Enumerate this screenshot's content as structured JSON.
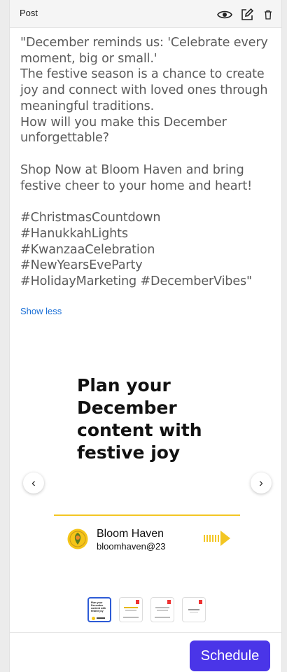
{
  "header": {
    "title": "Post",
    "icons": [
      "eye-icon",
      "edit-icon",
      "trash-icon"
    ]
  },
  "caption": {
    "paragraph1": "\"December reminds us: 'Celebrate every moment, big or small.'\nThe festive season is a chance to create joy and connect with loved ones through meaningful traditions.\nHow will you make this December unforgettable?",
    "paragraph2": "Shop Now at Bloom Haven and bring festive cheer to your home and heart!",
    "paragraph3": "#ChristmasCountdown\n#HanukkahLights\n#KwanzaaCelebration\n#NewYearsEveParty\n#HolidayMarketing #DecemberVibes\"",
    "toggle_label": "Show less"
  },
  "slide": {
    "headline": "Plan your December content with festive joy",
    "brand_name": "Bloom Haven",
    "brand_handle": "bloomhaven@23",
    "prev_label": "‹",
    "next_label": "›"
  },
  "thumbnails": {
    "count": 4,
    "active_index": 0,
    "first_label": "Plan your December content with festive joy"
  },
  "footer": {
    "schedule_label": "Schedule"
  },
  "colors": {
    "accent": "#4a35e8",
    "link": "#1a6fd6",
    "divider": "#f3c623",
    "arrow": "#f3c623"
  }
}
